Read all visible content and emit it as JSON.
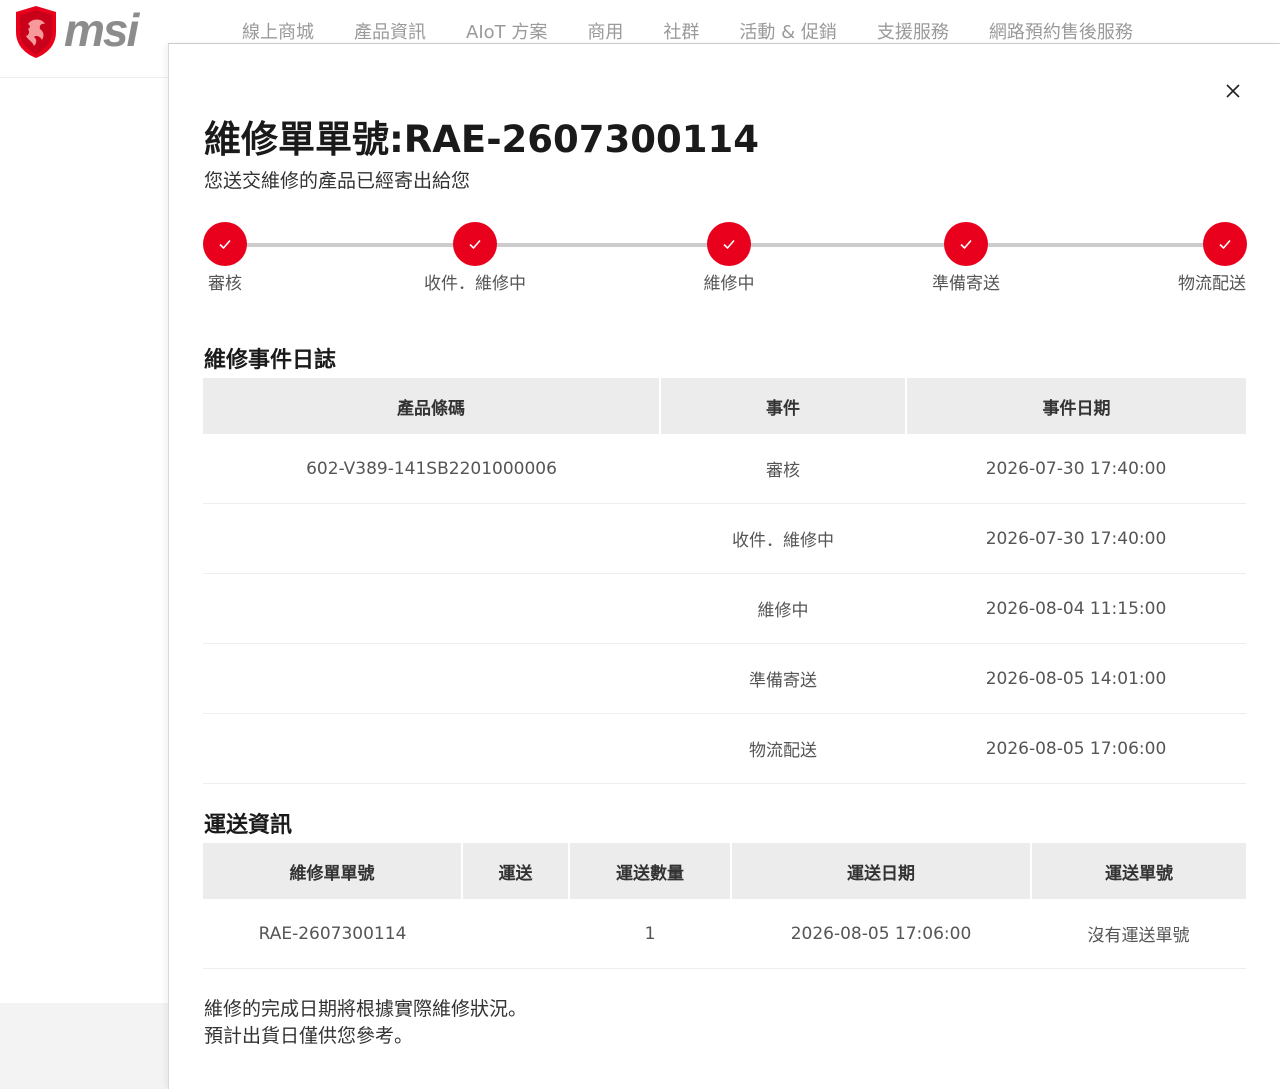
{
  "brand": {
    "name": "msi",
    "accent_color": "#e8001c"
  },
  "nav": {
    "items": [
      {
        "label": "線上商城"
      },
      {
        "label": "產品資訊"
      },
      {
        "label": "AIoT 方案"
      },
      {
        "label": "商用"
      },
      {
        "label": "社群"
      },
      {
        "label": "活動 & 促銷"
      },
      {
        "label": "支援服務"
      },
      {
        "label": "網路預約售後服務"
      }
    ]
  },
  "modal": {
    "title": "維修單單號:RAE-2607300114",
    "subtitle": "您送交維修的產品已經寄出給您",
    "close_icon": "close-icon",
    "steps": [
      {
        "label": "審核",
        "done": true
      },
      {
        "label": "收件．維修中",
        "done": true
      },
      {
        "label": "維修中",
        "done": true
      },
      {
        "label": "準備寄送",
        "done": true
      },
      {
        "label": "物流配送",
        "done": true
      }
    ],
    "event_log": {
      "title": "維修事件日誌",
      "headers": [
        "產品條碼",
        "事件",
        "事件日期"
      ],
      "rows": [
        [
          "602-V389-141SB2201000006",
          "審核",
          "2026-07-30 17:40:00"
        ],
        [
          "",
          "收件．維修中",
          "2026-07-30 17:40:00"
        ],
        [
          "",
          "維修中",
          "2026-08-04 11:15:00"
        ],
        [
          "",
          "準備寄送",
          "2026-08-05 14:01:00"
        ],
        [
          "",
          "物流配送",
          "2026-08-05 17:06:00"
        ]
      ]
    },
    "shipping": {
      "title": "運送資訊",
      "headers": [
        "維修單單號",
        "運送",
        "運送數量",
        "運送日期",
        "運送單號"
      ],
      "rows": [
        [
          "RAE-2607300114",
          "",
          "1",
          "2026-08-05 17:06:00",
          "沒有運送單號"
        ]
      ]
    },
    "note_lines": [
      "維修的完成日期將根據實際維修狀況。",
      "預計出貨日僅供您參考。"
    ]
  }
}
